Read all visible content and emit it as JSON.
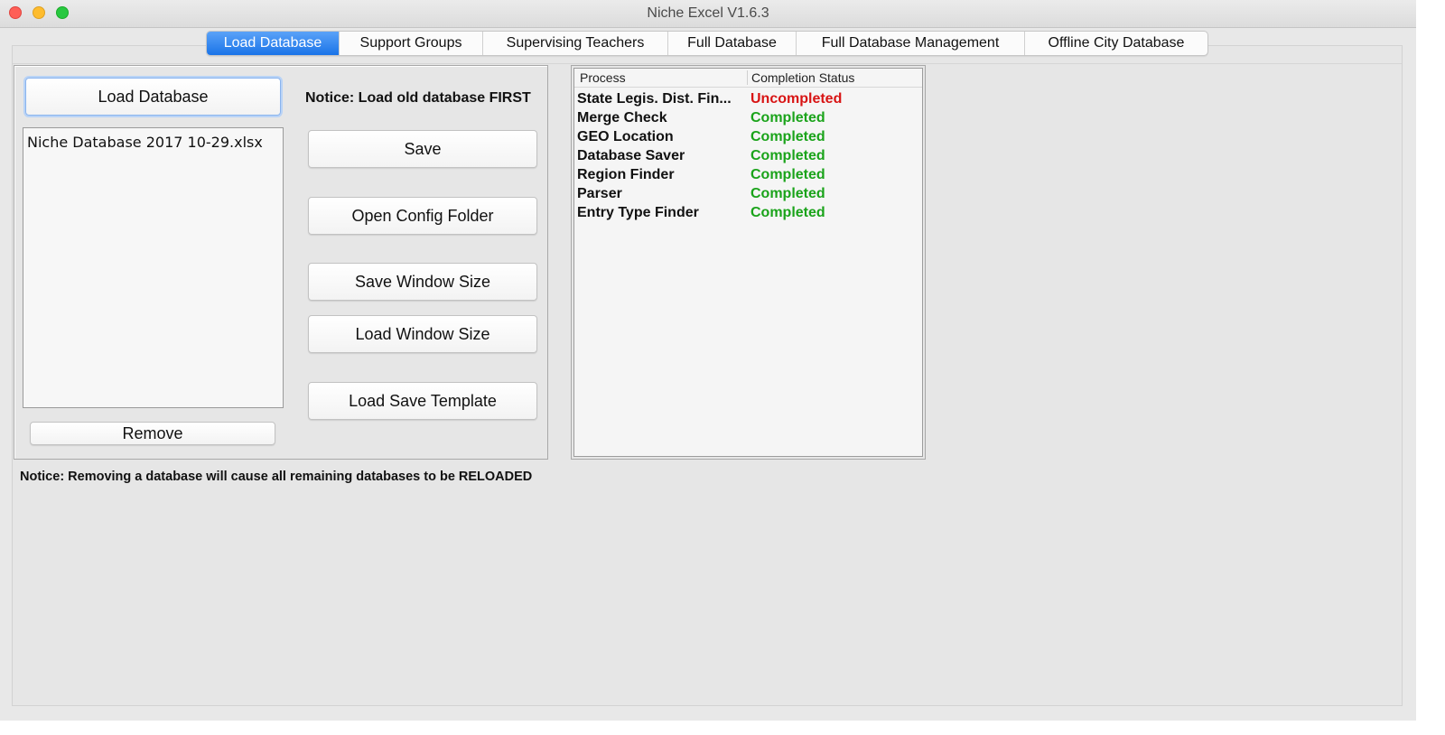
{
  "window": {
    "title": "Niche Excel V1.6.3"
  },
  "tabs": [
    {
      "label": "Load Database",
      "active": true
    },
    {
      "label": "Support Groups",
      "active": false
    },
    {
      "label": "Supervising Teachers",
      "active": false
    },
    {
      "label": "Full Database",
      "active": false
    },
    {
      "label": "Full Database Management",
      "active": false
    },
    {
      "label": "Offline City Database",
      "active": false
    }
  ],
  "left_panel": {
    "load_button": "Load Database",
    "notice_top": "Notice: Load old database FIRST",
    "files": [
      "Niche Database 2017 10-29.xlsx"
    ],
    "buttons": {
      "save": "Save",
      "open_config": "Open Config Folder",
      "save_window_size": "Save Window Size",
      "load_window_size": "Load Window Size",
      "load_save_template": "Load Save Template",
      "remove": "Remove"
    }
  },
  "notice_bottom": "Notice: Removing a database will cause all remaining databases to be RELOADED",
  "process_table": {
    "columns": [
      "Process",
      "Completion Status"
    ],
    "rows": [
      {
        "process": "State Legis. Dist. Fin...",
        "status": "Uncompleted"
      },
      {
        "process": "Merge Check",
        "status": "Completed"
      },
      {
        "process": "GEO Location",
        "status": "Completed"
      },
      {
        "process": "Database Saver",
        "status": "Completed"
      },
      {
        "process": "Region Finder",
        "status": "Completed"
      },
      {
        "process": "Parser",
        "status": "Completed"
      },
      {
        "process": "Entry Type Finder",
        "status": "Completed"
      }
    ]
  },
  "colors": {
    "accent_tab": "#1a74e8",
    "status_completed": "#1aa31a",
    "status_uncompleted": "#d81414"
  }
}
